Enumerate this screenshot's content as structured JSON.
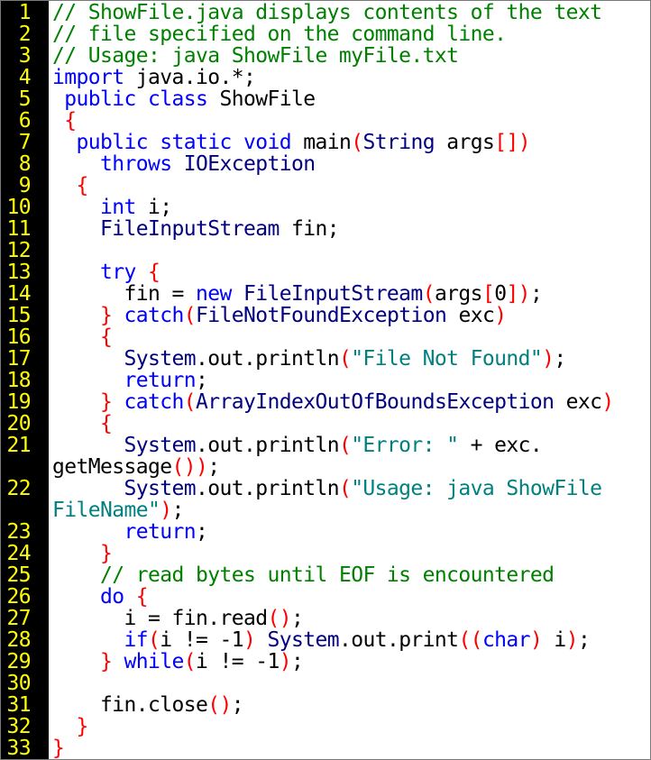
{
  "colors": {
    "gutter_background": "#000000",
    "line_number": "#ffff00",
    "comment": "#008000",
    "keyword": "#0000ff",
    "class": "#000080",
    "bracket": "#ff0000",
    "string": "#008080",
    "plain": "#000000"
  },
  "lines": [
    {
      "number": "1",
      "tokens": [
        {
          "t": "comment",
          "text": "// ShowFile.java displays contents of the text"
        }
      ]
    },
    {
      "number": "2",
      "tokens": [
        {
          "t": "comment",
          "text": "// file specified on the command line."
        }
      ]
    },
    {
      "number": "3",
      "tokens": [
        {
          "t": "comment",
          "text": "// Usage: java ShowFile myFile.txt"
        }
      ]
    },
    {
      "number": "4",
      "tokens": [
        {
          "t": "keyword",
          "text": "import"
        },
        {
          "t": "plain",
          "text": " java.io.*;"
        }
      ]
    },
    {
      "number": "5",
      "tokens": [
        {
          "t": "plain",
          "text": " "
        },
        {
          "t": "keyword",
          "text": "public"
        },
        {
          "t": "plain",
          "text": " "
        },
        {
          "t": "keyword",
          "text": "class"
        },
        {
          "t": "plain",
          "text": " ShowFile"
        }
      ]
    },
    {
      "number": "6",
      "tokens": [
        {
          "t": "plain",
          "text": " "
        },
        {
          "t": "bracket",
          "text": "{"
        }
      ]
    },
    {
      "number": "7",
      "tokens": [
        {
          "t": "plain",
          "text": "  "
        },
        {
          "t": "keyword",
          "text": "public"
        },
        {
          "t": "plain",
          "text": " "
        },
        {
          "t": "keyword",
          "text": "static"
        },
        {
          "t": "plain",
          "text": " "
        },
        {
          "t": "keyword",
          "text": "void"
        },
        {
          "t": "plain",
          "text": " main"
        },
        {
          "t": "bracket",
          "text": "("
        },
        {
          "t": "class",
          "text": "String"
        },
        {
          "t": "plain",
          "text": " args"
        },
        {
          "t": "bracket",
          "text": "[])"
        }
      ]
    },
    {
      "number": "8",
      "tokens": [
        {
          "t": "plain",
          "text": "    "
        },
        {
          "t": "keyword",
          "text": "throws"
        },
        {
          "t": "plain",
          "text": " "
        },
        {
          "t": "class",
          "text": "IOException"
        }
      ]
    },
    {
      "number": "9",
      "tokens": [
        {
          "t": "plain",
          "text": "  "
        },
        {
          "t": "bracket",
          "text": "{"
        }
      ]
    },
    {
      "number": "10",
      "tokens": [
        {
          "t": "plain",
          "text": "    "
        },
        {
          "t": "keyword",
          "text": "int"
        },
        {
          "t": "plain",
          "text": " i;"
        }
      ]
    },
    {
      "number": "11",
      "tokens": [
        {
          "t": "plain",
          "text": "    "
        },
        {
          "t": "class",
          "text": "FileInputStream"
        },
        {
          "t": "plain",
          "text": " fin;"
        }
      ]
    },
    {
      "number": "12",
      "tokens": []
    },
    {
      "number": "13",
      "tokens": [
        {
          "t": "plain",
          "text": "    "
        },
        {
          "t": "keyword",
          "text": "try"
        },
        {
          "t": "plain",
          "text": " "
        },
        {
          "t": "bracket",
          "text": "{"
        }
      ]
    },
    {
      "number": "14",
      "tokens": [
        {
          "t": "plain",
          "text": "      fin = "
        },
        {
          "t": "keyword",
          "text": "new"
        },
        {
          "t": "plain",
          "text": " "
        },
        {
          "t": "class",
          "text": "FileInputStream"
        },
        {
          "t": "bracket",
          "text": "("
        },
        {
          "t": "plain",
          "text": "args"
        },
        {
          "t": "bracket",
          "text": "["
        },
        {
          "t": "plain",
          "text": "0"
        },
        {
          "t": "bracket",
          "text": "])"
        },
        {
          "t": "plain",
          "text": ";"
        }
      ]
    },
    {
      "number": "15",
      "tokens": [
        {
          "t": "plain",
          "text": "    "
        },
        {
          "t": "bracket",
          "text": "}"
        },
        {
          "t": "plain",
          "text": " "
        },
        {
          "t": "keyword",
          "text": "catch"
        },
        {
          "t": "bracket",
          "text": "("
        },
        {
          "t": "class",
          "text": "FileNotFoundException"
        },
        {
          "t": "plain",
          "text": " exc"
        },
        {
          "t": "bracket",
          "text": ")"
        }
      ]
    },
    {
      "number": "16",
      "tokens": [
        {
          "t": "plain",
          "text": "    "
        },
        {
          "t": "bracket",
          "text": "{"
        }
      ]
    },
    {
      "number": "17",
      "tokens": [
        {
          "t": "plain",
          "text": "      "
        },
        {
          "t": "class",
          "text": "System"
        },
        {
          "t": "plain",
          "text": ".out.println"
        },
        {
          "t": "bracket",
          "text": "("
        },
        {
          "t": "string",
          "text": "\"File Not Found\""
        },
        {
          "t": "bracket",
          "text": ")"
        },
        {
          "t": "plain",
          "text": ";"
        }
      ]
    },
    {
      "number": "18",
      "tokens": [
        {
          "t": "plain",
          "text": "      "
        },
        {
          "t": "keyword",
          "text": "return"
        },
        {
          "t": "plain",
          "text": ";"
        }
      ]
    },
    {
      "number": "19",
      "tokens": [
        {
          "t": "plain",
          "text": "    "
        },
        {
          "t": "bracket",
          "text": "}"
        },
        {
          "t": "plain",
          "text": " "
        },
        {
          "t": "keyword",
          "text": "catch"
        },
        {
          "t": "bracket",
          "text": "("
        },
        {
          "t": "class",
          "text": "ArrayIndexOutOfBoundsException"
        },
        {
          "t": "plain",
          "text": " exc"
        },
        {
          "t": "bracket",
          "text": ")"
        }
      ]
    },
    {
      "number": "20",
      "tokens": [
        {
          "t": "plain",
          "text": "    "
        },
        {
          "t": "bracket",
          "text": "{"
        }
      ]
    },
    {
      "number": "21",
      "tokens": [
        {
          "t": "plain",
          "text": "      "
        },
        {
          "t": "class",
          "text": "System"
        },
        {
          "t": "plain",
          "text": ".out.println"
        },
        {
          "t": "bracket",
          "text": "("
        },
        {
          "t": "string",
          "text": "\"Error: \""
        },
        {
          "t": "plain",
          "text": " + exc.\ngetMessage"
        },
        {
          "t": "bracket",
          "text": "())"
        },
        {
          "t": "plain",
          "text": ";"
        }
      ]
    },
    {
      "number": "22",
      "tokens": [
        {
          "t": "plain",
          "text": "      "
        },
        {
          "t": "class",
          "text": "System"
        },
        {
          "t": "plain",
          "text": ".out.println"
        },
        {
          "t": "bracket",
          "text": "("
        },
        {
          "t": "string",
          "text": "\"Usage: java ShowFile\nFileName\""
        },
        {
          "t": "bracket",
          "text": ")"
        },
        {
          "t": "plain",
          "text": ";"
        }
      ]
    },
    {
      "number": "23",
      "tokens": [
        {
          "t": "plain",
          "text": "      "
        },
        {
          "t": "keyword",
          "text": "return"
        },
        {
          "t": "plain",
          "text": ";"
        }
      ]
    },
    {
      "number": "24",
      "tokens": [
        {
          "t": "plain",
          "text": "    "
        },
        {
          "t": "bracket",
          "text": "}"
        }
      ]
    },
    {
      "number": "25",
      "tokens": [
        {
          "t": "plain",
          "text": "    "
        },
        {
          "t": "comment",
          "text": "// read bytes until EOF is encountered"
        }
      ]
    },
    {
      "number": "26",
      "tokens": [
        {
          "t": "plain",
          "text": "    "
        },
        {
          "t": "keyword",
          "text": "do"
        },
        {
          "t": "plain",
          "text": " "
        },
        {
          "t": "bracket",
          "text": "{"
        }
      ]
    },
    {
      "number": "27",
      "tokens": [
        {
          "t": "plain",
          "text": "      i = fin.read"
        },
        {
          "t": "bracket",
          "text": "()"
        },
        {
          "t": "plain",
          "text": ";"
        }
      ]
    },
    {
      "number": "28",
      "tokens": [
        {
          "t": "plain",
          "text": "      "
        },
        {
          "t": "keyword",
          "text": "if"
        },
        {
          "t": "bracket",
          "text": "("
        },
        {
          "t": "plain",
          "text": "i != -1"
        },
        {
          "t": "bracket",
          "text": ")"
        },
        {
          "t": "plain",
          "text": " "
        },
        {
          "t": "class",
          "text": "System"
        },
        {
          "t": "plain",
          "text": ".out.print"
        },
        {
          "t": "bracket",
          "text": "(("
        },
        {
          "t": "keyword",
          "text": "char"
        },
        {
          "t": "bracket",
          "text": ")"
        },
        {
          "t": "plain",
          "text": " i"
        },
        {
          "t": "bracket",
          "text": ")"
        },
        {
          "t": "plain",
          "text": ";"
        }
      ]
    },
    {
      "number": "29",
      "tokens": [
        {
          "t": "plain",
          "text": "    "
        },
        {
          "t": "bracket",
          "text": "}"
        },
        {
          "t": "plain",
          "text": " "
        },
        {
          "t": "keyword",
          "text": "while"
        },
        {
          "t": "bracket",
          "text": "("
        },
        {
          "t": "plain",
          "text": "i != -1"
        },
        {
          "t": "bracket",
          "text": ")"
        },
        {
          "t": "plain",
          "text": ";"
        }
      ]
    },
    {
      "number": "30",
      "tokens": []
    },
    {
      "number": "31",
      "tokens": [
        {
          "t": "plain",
          "text": "    fin.close"
        },
        {
          "t": "bracket",
          "text": "()"
        },
        {
          "t": "plain",
          "text": ";"
        }
      ]
    },
    {
      "number": "32",
      "tokens": [
        {
          "t": "plain",
          "text": "  "
        },
        {
          "t": "bracket",
          "text": "}"
        }
      ]
    },
    {
      "number": "33",
      "tokens": [
        {
          "t": "bracket",
          "text": "}"
        }
      ]
    }
  ]
}
